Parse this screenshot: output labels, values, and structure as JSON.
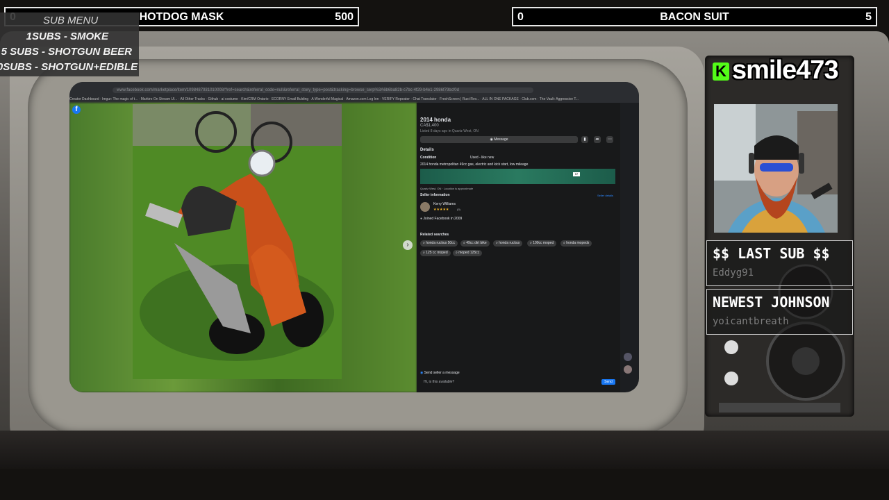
{
  "goals": {
    "left": {
      "count": "0",
      "title": "HOTDOG MASK",
      "target": "500"
    },
    "right": {
      "count": "0",
      "title": "BACON SUIT",
      "target": "5"
    }
  },
  "sub_menu": {
    "title": "SUB MENU",
    "items": [
      "1SUBS   - SMOKE",
      "5 SUBS  - SHOTGUN BEER",
      "10SUBS - SHOTGUN+EDIBLE"
    ]
  },
  "brand": {
    "name": "smile473",
    "platform_icon": "kick-icon",
    "accent": "#53fc18"
  },
  "last_sub": {
    "heading": "$$ LAST SUB $$",
    "value": "Eddyg91"
  },
  "newest_johnson": {
    "heading": "NEWEST JOHNSON",
    "value": "yoicantbreath"
  },
  "browser": {
    "url": "www.facebook.com/marketplace/item/1098487931010008/?ref=search&referral_code=null&referral_story_type=post&tracking=browse_serp%3A6b6ba82b-c7bc-4f29-b4e1-2986f79bcf0d",
    "bookmarks": [
      "Creator Dashboard",
      "Imgur: The magic of t...",
      "Markiro On Stream Ul...",
      "All Other Tracks",
      "Github - ai costume",
      "Kim/CRM Ontario",
      "ECORNY Email Bulding",
      "A Wonderful Magical",
      "Amazon.com Log Inn",
      "VERIFY Repeater",
      "Chat Translator",
      "FreshScreen | Rust Rev...",
      "ALL IN ONE PACKAGE",
      "Club.com",
      "The Vault: Aggressive T..."
    ]
  },
  "listing": {
    "title": "2014 honda",
    "price": "CA$1,400",
    "listed": "Listed 8 days ago in Quartz West, ON",
    "message_label": "Message",
    "details_heading": "Details",
    "condition_label": "Condition",
    "condition_value": "Used - like new",
    "description": "2014 honda metropolitan 49cc gas, electric and kick start, low mileage",
    "map_badge": "57",
    "location": "Quartz West, ON  · Location is approximate",
    "seller_heading": "Seller information",
    "seller_link": "Seller details",
    "seller_name": "Kerry Williams",
    "seller_rating": "(9)",
    "joined": "Joined Facebook in 2009",
    "related_heading": "Related searches",
    "related": [
      "honda ruckus 50cc",
      "49cc dirt bike",
      "honda ruckus",
      "100cc moped",
      "honda mopeds",
      "125 cc moped",
      "moped 125cc"
    ],
    "send_label": "Send seller a message",
    "message_text": "Hi, is this available?",
    "send_button": "Send"
  }
}
